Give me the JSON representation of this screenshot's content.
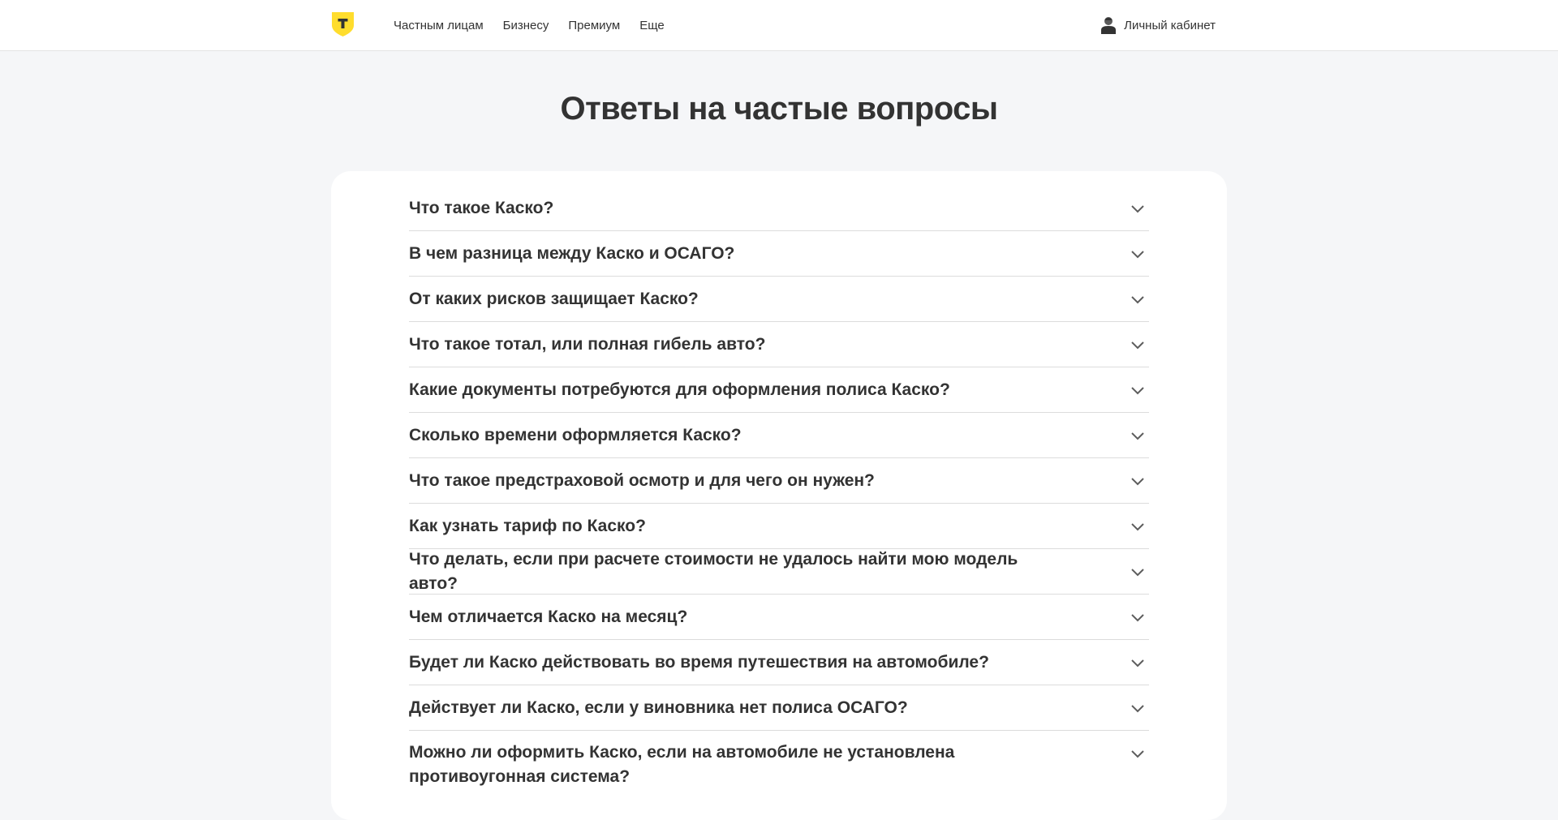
{
  "header": {
    "nav": [
      "Частным лицам",
      "Бизнесу",
      "Премиум",
      "Еще"
    ],
    "account_label": "Личный кабинет"
  },
  "title": "Ответы на частые вопросы",
  "faq": [
    "Что такое Каско?",
    "В чем разница между Каско и ОСАГО?",
    "От каких рисков защищает Каско?",
    "Что такое тотал, или полная гибель авто?",
    "Какие документы потребуются для оформления полиса Каско?",
    "Сколько времени оформляется Каско?",
    "Что такое предстраховой осмотр и для чего он нужен?",
    "Как узнать тариф по Каско?",
    "Что делать, если при расчете стоимости не удалось найти мою модель авто?",
    "Чем отличается Каско на месяц?",
    "Будет ли Каско действовать во время путешествия на автомобиле?",
    "Действует ли Каско, если у виновника нет полиса ОСАГО?",
    "Можно ли оформить Каско, если на автомобиле не установлена противоугонная система?"
  ],
  "colors": {
    "brand_yellow": "#ffdd2d",
    "page_bg": "#f5f6f8",
    "text": "#333333"
  },
  "icons": {
    "logo": "shield-logo-icon",
    "account": "user-icon",
    "expand": "chevron-down-icon"
  }
}
